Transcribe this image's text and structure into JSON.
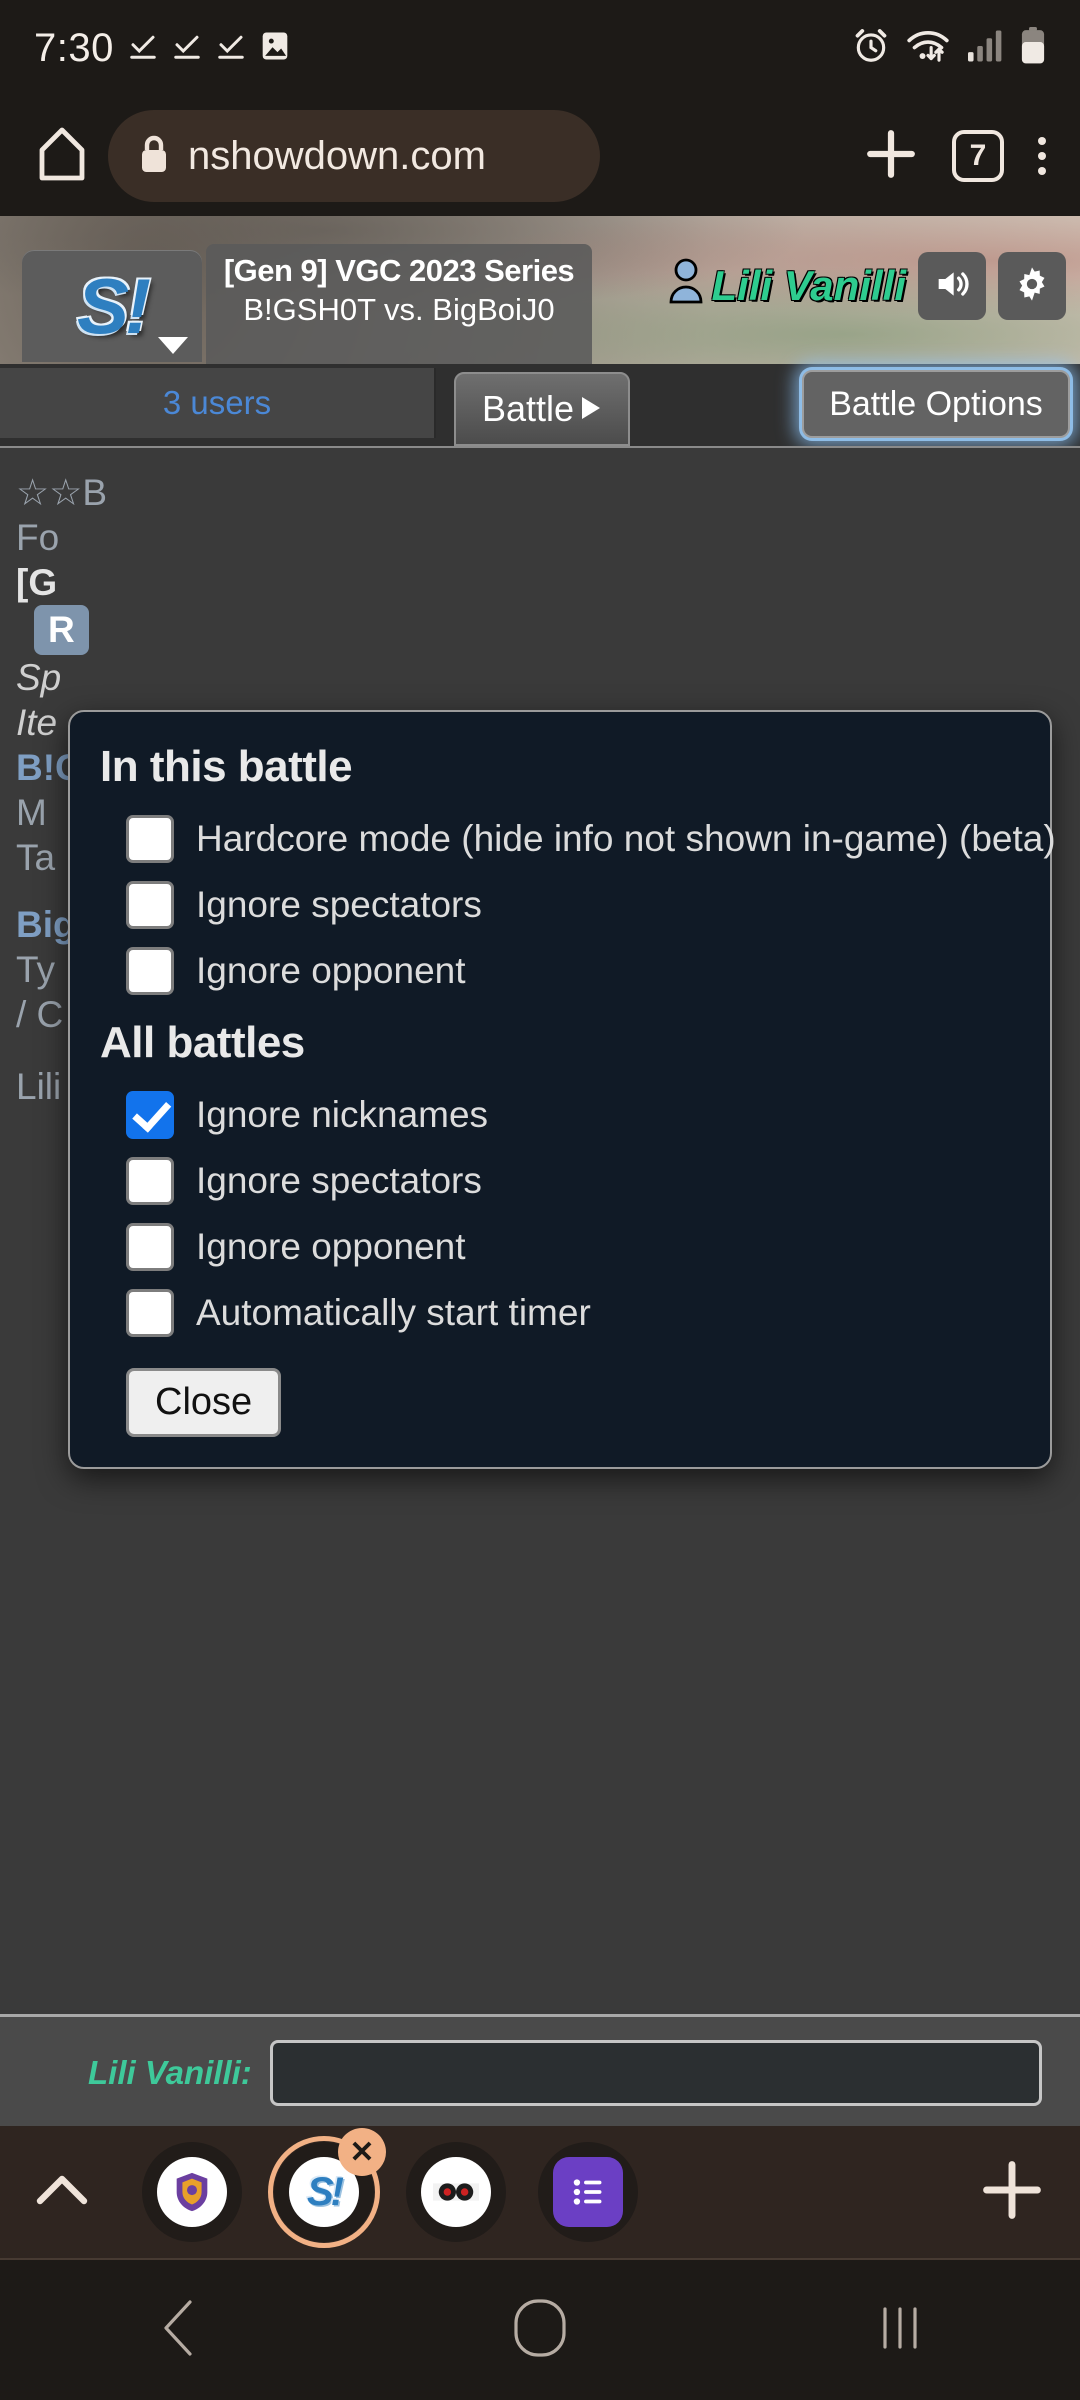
{
  "status_bar": {
    "time": "7:30",
    "left_icons": [
      "check-underline-icon",
      "check-underline-icon",
      "check-underline-icon",
      "image-icon"
    ],
    "right_icons": [
      "alarm-icon",
      "wifi-icon",
      "signal-icon",
      "battery-icon"
    ]
  },
  "browser": {
    "home_icon": "home-icon",
    "lock_icon": "lock-icon",
    "url": "nshowdown.com",
    "new_tab_icon": "plus-icon",
    "tab_count": "7",
    "menu_icon": "overflow-menu-icon"
  },
  "showdown_header": {
    "logo_label": "S!",
    "logo_caret_icon": "chevron-down-icon",
    "room_format": "[Gen 9] VGC 2023 Series",
    "room_players": "B!GSH0T vs. BigBoiJ0",
    "user_icon": "person-icon",
    "username": "Lili Vanilli",
    "sound_icon": "speaker-icon",
    "settings_icon": "gear-icon"
  },
  "tab_row": {
    "users_label": "3 users",
    "battle_label": "Battle",
    "battle_caret_icon": "triangle-right-icon",
    "battle_options_label": "Battle Options"
  },
  "chat_background": {
    "lines": [
      "☆B",
      "Fo",
      "[G",
      "R",
      "Sp",
      "Ite",
      "B!G",
      "M",
      "Ta",
      "Big",
      "Ty",
      "/ C",
      "Lili"
    ]
  },
  "popup": {
    "section_one_title": "In this battle",
    "section_one_items": [
      {
        "label": "Hardcore mode (hide info not shown in-game) (beta)",
        "checked": false
      },
      {
        "label": "Ignore spectators",
        "checked": false
      },
      {
        "label": "Ignore opponent",
        "checked": false
      }
    ],
    "section_two_title": "All battles",
    "section_two_items": [
      {
        "label": "Ignore nicknames",
        "checked": true
      },
      {
        "label": "Ignore spectators",
        "checked": false
      },
      {
        "label": "Ignore opponent",
        "checked": false
      },
      {
        "label": "Automatically start timer",
        "checked": false
      }
    ],
    "close_label": "Close",
    "accent_checked_color": "#1273ec",
    "background_color": "#101a26"
  },
  "chat_bar": {
    "username_label": "Lili Vanilli:",
    "input_value": "",
    "input_placeholder": ""
  },
  "tab_strip": {
    "expand_icon": "chevron-up-icon",
    "tabs": [
      {
        "name": "crest-favicon",
        "glyph": "🦁",
        "active": false
      },
      {
        "name": "showdown-favicon",
        "glyph": "S!",
        "active": true
      },
      {
        "name": "dark-favicon",
        "glyph": "◉◉",
        "active": false
      },
      {
        "name": "list-favicon",
        "glyph": "☰",
        "active": false
      }
    ],
    "close_badge_icon": "close-icon",
    "new_tab_icon": "plus-icon",
    "active_ring_color": "#f2b185"
  },
  "android_nav": {
    "back_icon": "chevron-left-icon",
    "home_icon": "home-square-icon",
    "recents_icon": "recents-bars-icon"
  }
}
